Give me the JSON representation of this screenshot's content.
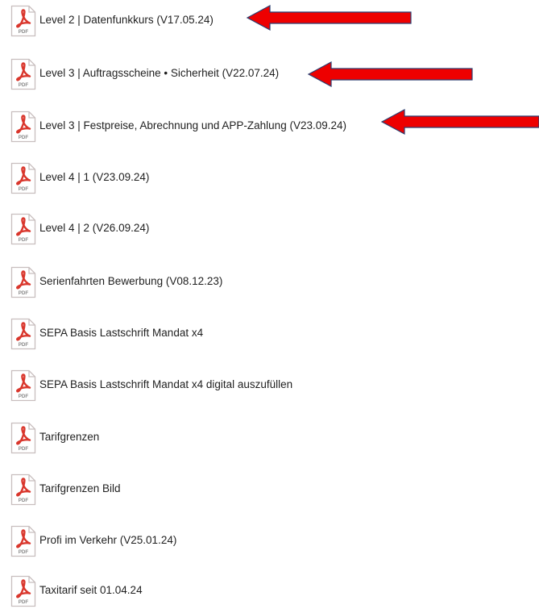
{
  "icon": {
    "name": "pdf-file-icon",
    "badge": "PDF",
    "accent_color": "#d9362c",
    "border_color": "#c8bebe"
  },
  "arrow_color": "#ee0000",
  "files": [
    {
      "label": "Level 2 | Datenfunkkurs (V17.05.24)",
      "highlighted": true
    },
    {
      "label": "Level 3 | Auftragsscheine • Sicherheit (V22.07.24)",
      "highlighted": true
    },
    {
      "label": "Level 3 | Festpreise, Abrechnung und APP-Zahlung (V23.09.24)",
      "highlighted": true
    },
    {
      "label": "Level 4 | 1 (V23.09.24)",
      "highlighted": false
    },
    {
      "label": "Level 4 | 2 (V26.09.24)",
      "highlighted": false
    },
    {
      "label": "Serienfahrten Bewerbung (V08.12.23)",
      "highlighted": false
    },
    {
      "label": "SEPA Basis Lastschrift Mandat x4",
      "highlighted": false
    },
    {
      "label": "SEPA Basis Lastschrift Mandat x4 digital auszufüllen",
      "highlighted": false
    },
    {
      "label": "Tarifgrenzen",
      "highlighted": false
    },
    {
      "label": "Tarifgrenzen Bild",
      "highlighted": false
    },
    {
      "label": "Profi im Verkehr (V25.01.24)",
      "highlighted": false
    },
    {
      "label": "Taxitarif seit 01.04.24",
      "highlighted": false
    }
  ]
}
